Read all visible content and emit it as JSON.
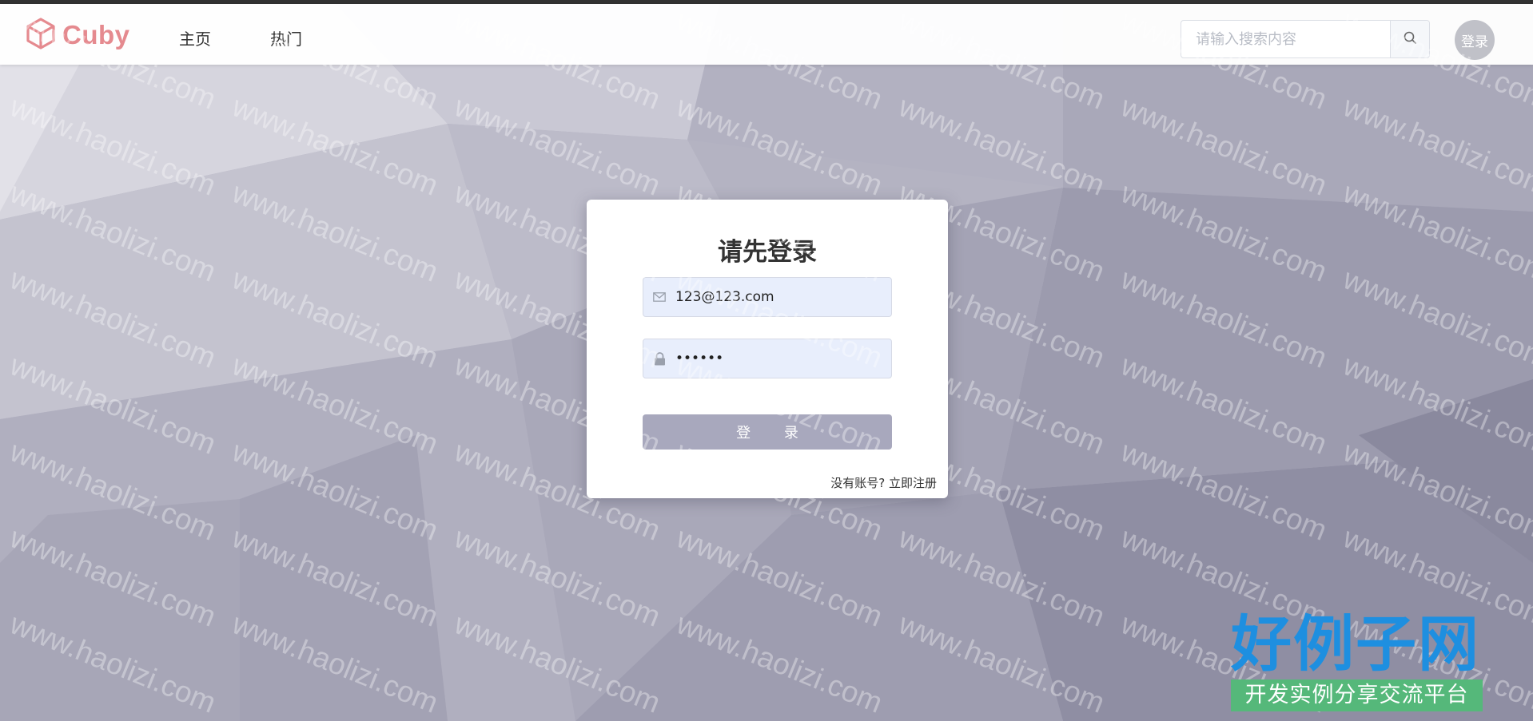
{
  "header": {
    "logo_text": "Cuby",
    "nav": [
      {
        "label": "主页"
      },
      {
        "label": "热门"
      }
    ],
    "search": {
      "placeholder": "请输入搜索内容",
      "value": ""
    },
    "avatar_label": "登录"
  },
  "login": {
    "title": "请先登录",
    "email_value": "123@123.com",
    "password_value": "123456",
    "submit_label": "登 录",
    "register_prompt": "没有账号?",
    "register_link": "立即注册"
  },
  "watermark": {
    "text": "www.haolizi.com",
    "brand_title": "好例子网",
    "brand_subtitle": "开发实例分享交流平台"
  },
  "icons": {
    "logo": "cube-icon",
    "search": "search-icon",
    "email": "envelope-icon",
    "password": "lock-icon"
  },
  "colors": {
    "logo": "#e58a8f",
    "background": "#b9b8c6",
    "input_bg": "#e8eefc",
    "button": "#a8a8bd",
    "brand_blue": "#1e8fe0",
    "brand_green": "#55b87a"
  }
}
